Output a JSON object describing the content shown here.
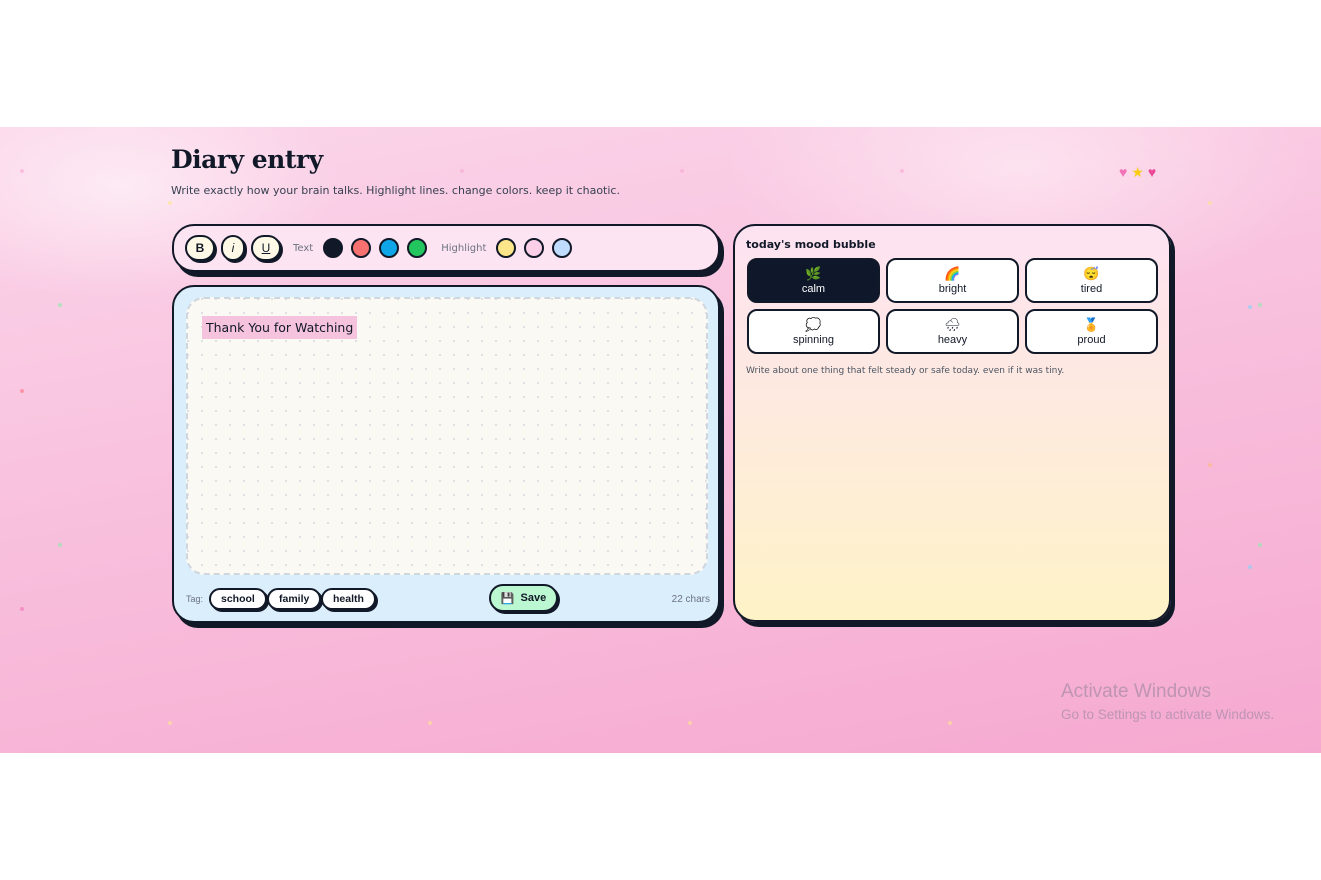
{
  "header": {
    "title": "Diary entry",
    "subtitle": "Write exactly how your brain talks. Highlight lines. change colors. keep it chaotic.",
    "decorations": [
      "♥",
      "★",
      "♥"
    ]
  },
  "toolbar": {
    "bold_label": "B",
    "italic_label": "i",
    "underline_label": "U",
    "text_label": "Text",
    "text_colors": [
      "#111827",
      "#f87171",
      "#0ea5e9",
      "#22c55e"
    ],
    "highlight_label": "Highlight",
    "highlight_colors": [
      "#fde68a",
      "#fbcfe8",
      "#bfdbfe"
    ]
  },
  "editor": {
    "content": "Thank You for Watching",
    "highlight_color": "#f6c3de",
    "tag_label": "Tag:",
    "tags": [
      "school",
      "family",
      "health"
    ],
    "save_icon": "💾",
    "save_label": "Save",
    "char_count": "22 chars"
  },
  "mood": {
    "title": "today's mood bubble",
    "options": [
      {
        "emoji": "🌿",
        "label": "calm",
        "selected": true
      },
      {
        "emoji": "🌈",
        "label": "bright",
        "selected": false
      },
      {
        "emoji": "😴",
        "label": "tired",
        "selected": false
      },
      {
        "emoji": "💭",
        "label": "spinning",
        "selected": false
      },
      {
        "emoji": "🌧",
        "label": "heavy",
        "selected": false
      },
      {
        "emoji": "🏅",
        "label": "proud",
        "selected": false
      }
    ],
    "hint": "Write about one thing that felt steady or safe today. even if it was tiny."
  },
  "watermark": {
    "line1": "Activate Windows",
    "line2": "Go to Settings to activate Windows."
  }
}
